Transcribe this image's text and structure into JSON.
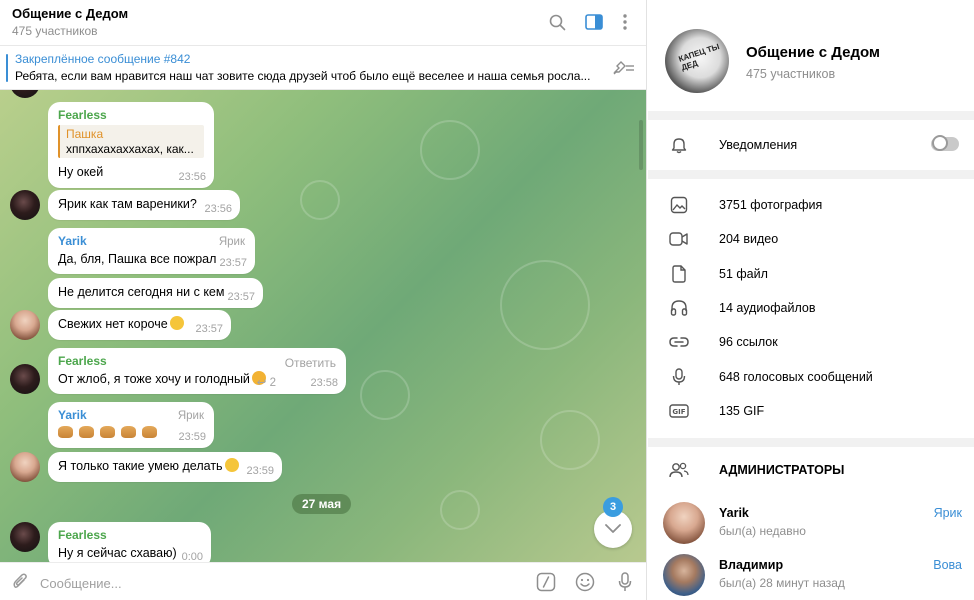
{
  "chat": {
    "title": "Общение с Дедом",
    "members": "475 участников"
  },
  "pinned": {
    "title": "Закреплённое сообщение #842",
    "text": "Ребята, если вам нравится наш чат зовите сюда друзей чтоб было ещё веселее и наша семья росла..."
  },
  "messages": [
    {
      "sender": "Fearless",
      "reply_name": "Пашка",
      "reply_text": "хппхахахаххахах, как...",
      "text": "Ну окей",
      "time": "23:56"
    },
    {
      "text": "Ярик как там вареники?",
      "time": "23:56"
    },
    {
      "sender": "Yarik",
      "tag": "Ярик",
      "text": "Да, бля, Пашка все пожрал",
      "time": "23:57"
    },
    {
      "text": "Не делится сегодня ни с кем",
      "time": "23:57"
    },
    {
      "text": "Свежих нет короче",
      "time": "23:57"
    },
    {
      "sender": "Fearless",
      "reply_link": "Ответить",
      "text": "От жлоб, я тоже хочу и голодный",
      "replies": "2",
      "time": "23:58"
    },
    {
      "sender": "Yarik",
      "tag": "Ярик",
      "time": "23:59"
    },
    {
      "text": "Я только такие умею делать",
      "time": "23:59"
    },
    {
      "sender": "Fearless",
      "text": "Ну я сейчас схаваю)",
      "time": "0:00"
    }
  ],
  "date_separator": "27 мая",
  "unread_count": "3",
  "composer": {
    "placeholder": "Сообщение..."
  },
  "info": {
    "name": "Общение с Дедом",
    "members": "475 участников",
    "avatar_caption": "КАПЕЦ ТЫ ДЕД",
    "notifications_label": "Уведомления",
    "notifications_on": false,
    "media": [
      {
        "icon": "photo-icon",
        "label": "3751 фотография"
      },
      {
        "icon": "video-icon",
        "label": "204 видео"
      },
      {
        "icon": "file-icon",
        "label": "51 файл"
      },
      {
        "icon": "headphones-icon",
        "label": "14 аудиофайлов"
      },
      {
        "icon": "link-icon",
        "label": "96 ссылок"
      },
      {
        "icon": "microphone-icon",
        "label": "648 голосовых сообщений"
      },
      {
        "icon": "gif-icon",
        "label": "135 GIF"
      }
    ],
    "admins_title": "АДМИНИСТРАТОРЫ",
    "admins": [
      {
        "name": "Yarik",
        "status": "был(а) недавно",
        "tag": "Ярик"
      },
      {
        "name": "Владимир",
        "status": "был(а) 28 минут назад",
        "tag": "Вова"
      }
    ]
  },
  "colors": {
    "accent": "#3a8ed5",
    "green_name": "#4ca64c",
    "reply_orange": "#e0922a"
  }
}
